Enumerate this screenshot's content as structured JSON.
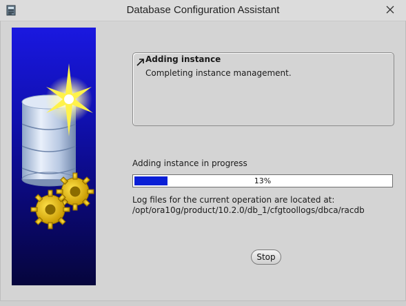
{
  "window": {
    "title": "Database Configuration Assistant",
    "icons": {
      "app": "application-icon",
      "close": "close-icon"
    }
  },
  "art": {
    "icons": [
      "database-cylinder-icon",
      "starburst-icon",
      "gear-icon"
    ]
  },
  "step": {
    "heading": "Adding instance",
    "detail": "Completing instance management.",
    "icon": "current-step-arrow-icon"
  },
  "progress": {
    "label": "Adding instance in progress",
    "percent": 13,
    "percent_text": "13%",
    "fill_color": "#0a1fd6"
  },
  "log": {
    "line1": "Log files for the current operation are located at:",
    "line2": "/opt/ora10g/product/10.2.0/db_1/cfgtoollogs/dbca/racdb"
  },
  "actions": {
    "stop_label": "Stop"
  }
}
